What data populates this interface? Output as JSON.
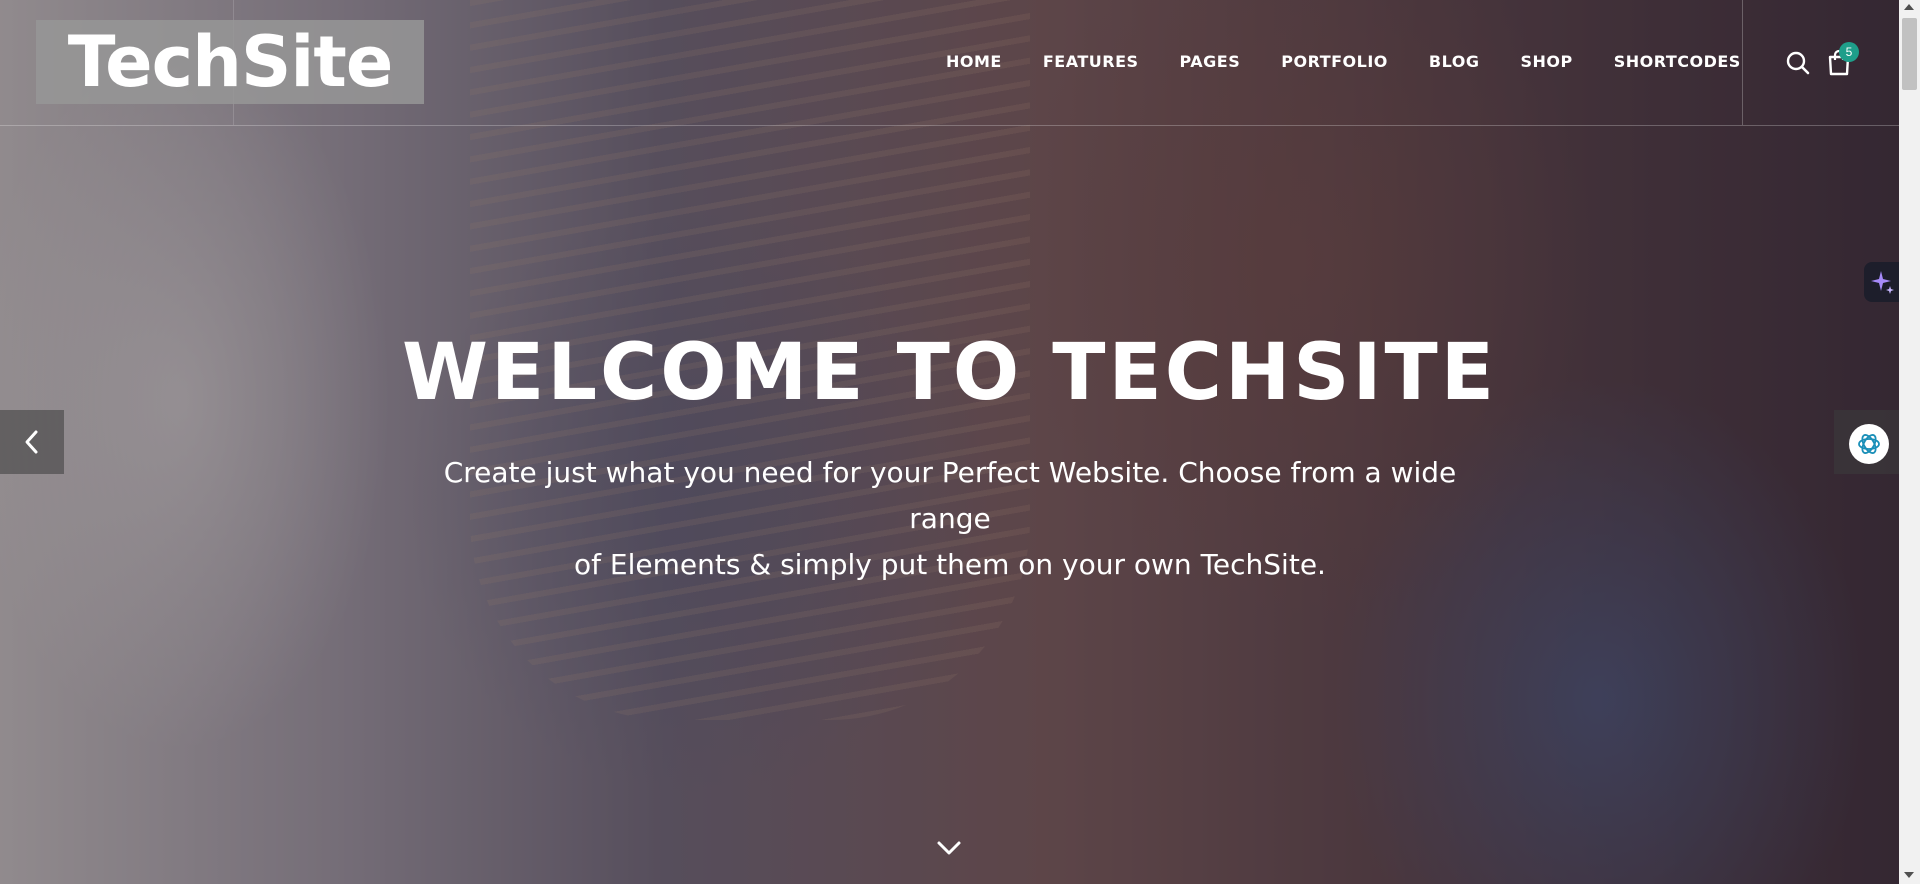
{
  "brand": {
    "logo_text": "TechSite"
  },
  "nav": {
    "items": [
      {
        "label": "HOME"
      },
      {
        "label": "FEATURES"
      },
      {
        "label": "PAGES"
      },
      {
        "label": "PORTFOLIO"
      },
      {
        "label": "BLOG"
      },
      {
        "label": "SHOP"
      },
      {
        "label": "SHORTCODES"
      }
    ]
  },
  "header_icons": {
    "search": "search-icon",
    "cart": "shopping-bag-icon",
    "cart_count": "5"
  },
  "hero": {
    "title": "WELCOME TO TECHSITE",
    "subtitle_line1": "Create just what you need for your Perfect Website. Choose from a wide range",
    "subtitle_line2": "of Elements & simply put them on your own TechSite."
  },
  "controls": {
    "prev": "chevron-left-icon",
    "scroll": "chevron-down-icon"
  },
  "colors": {
    "badge": "#1e9e8a",
    "logo_bg": "#969696",
    "sparkle": "#a78bfa"
  }
}
